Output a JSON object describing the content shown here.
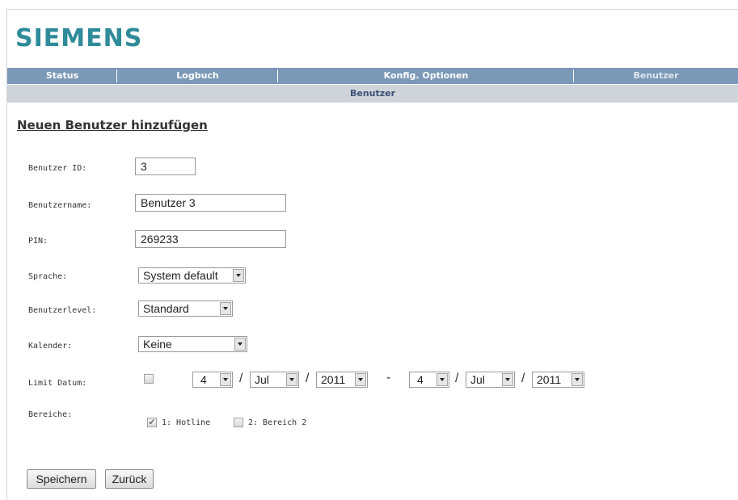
{
  "logo": "SIEMENS",
  "nav": {
    "items": [
      {
        "label": "Status"
      },
      {
        "label": "Logbuch"
      },
      {
        "label": "Konfig. Optionen"
      },
      {
        "label": "Benutzer"
      }
    ],
    "subtitle": "Benutzer"
  },
  "form": {
    "heading": "Neuen Benutzer hinzufügen",
    "user_id": {
      "label": "Benutzer ID:",
      "value": "3"
    },
    "username": {
      "label": "Benutzername:",
      "value": "Benutzer 3"
    },
    "pin": {
      "label": "PIN:",
      "value": "269233"
    },
    "language": {
      "label": "Sprache:",
      "value": "System default"
    },
    "user_level": {
      "label": "Benutzerlevel:",
      "value": "Standard"
    },
    "calendar": {
      "label": "Kalender:",
      "value": "Keine"
    },
    "limit_date": {
      "label": "Limit Datum:",
      "checked": false,
      "from": {
        "day": "4",
        "month": "Jul",
        "year": "2011"
      },
      "to": {
        "day": "4",
        "month": "Jul",
        "year": "2011"
      },
      "slash": "/",
      "dash": "-"
    },
    "areas": {
      "label": "Bereiche:",
      "items": [
        {
          "label": "1: Hotline",
          "checked": true
        },
        {
          "label": "2: Bereich 2",
          "checked": false
        }
      ]
    }
  },
  "buttons": {
    "save": "Speichern",
    "back": "Zurück"
  }
}
